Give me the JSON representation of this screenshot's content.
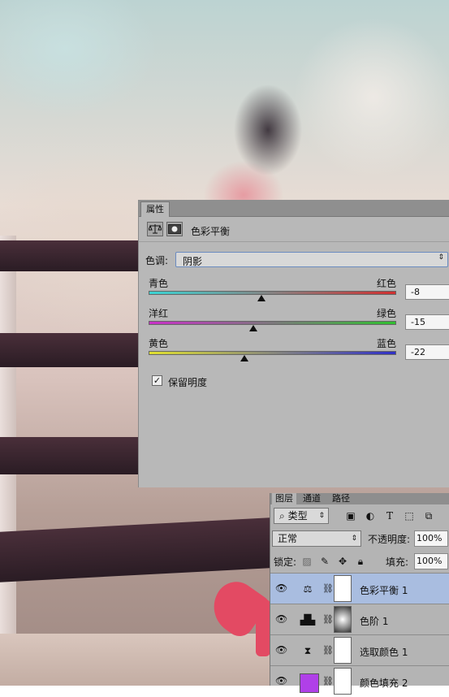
{
  "properties_panel": {
    "tab_label": "属性",
    "title": "色彩平衡",
    "tone": {
      "label": "色调:",
      "value": "阴影"
    },
    "sliders": [
      {
        "left_label": "青色",
        "right_label": "红色",
        "value": "-8",
        "level": -8,
        "colors": [
          "#3bd3d3",
          "#d03030"
        ]
      },
      {
        "left_label": "洋红",
        "right_label": "绿色",
        "value": "-15",
        "level": -15,
        "colors": [
          "#c830c8",
          "#30c030"
        ]
      },
      {
        "left_label": "黄色",
        "right_label": "蓝色",
        "value": "-22",
        "level": -22,
        "colors": [
          "#e0e030",
          "#3030c8"
        ]
      }
    ],
    "preserve_luminosity": {
      "label": "保留明度",
      "checked": true
    }
  },
  "layers_panel": {
    "tabs": [
      "图层",
      "通道",
      "路径"
    ],
    "filter": {
      "label": "类型"
    },
    "blend_mode": "正常",
    "opacity": {
      "label": "不透明度:",
      "value": "100%"
    },
    "lock": {
      "label": "锁定:"
    },
    "fill": {
      "label": "填充:",
      "value": "100%"
    },
    "layers": [
      {
        "name": "色彩平衡 1",
        "icon": "balance-icon",
        "selected": true
      },
      {
        "name": "色阶 1",
        "icon": "levels-histogram-icon",
        "selected": false
      },
      {
        "name": "选取颜色 1",
        "icon": "selective-color-icon",
        "selected": false
      },
      {
        "name": "颜色填充 2",
        "icon": "color-fill-swatch",
        "selected": false,
        "swatch": "#b040e8"
      }
    ]
  },
  "colors": {
    "selected_layer": "#a9bde0",
    "panel": "#b8b8b8"
  }
}
